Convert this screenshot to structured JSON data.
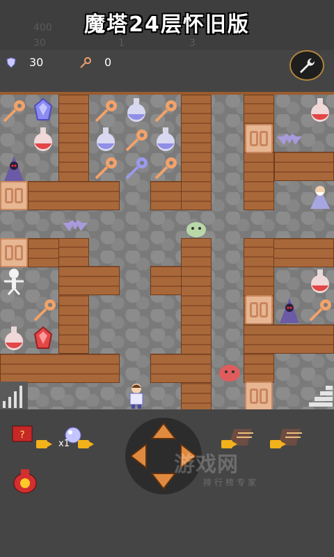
{
  "header": {
    "title": "魔塔24层怀旧版",
    "ghost_stats": [
      "400",
      "30",
      "1",
      "3"
    ]
  },
  "stats": {
    "defense": {
      "icon": "shield-icon",
      "value": "30"
    },
    "keys": {
      "icon": "key-icon",
      "value": "0"
    }
  },
  "settings": {
    "icon": "wrench-icon"
  },
  "inventory": {
    "book": {
      "icon": "monster-manual-icon"
    },
    "orb": {
      "icon": "crystal-orb-icon",
      "count": "x1"
    },
    "bag": {
      "icon": "lucky-bag-icon"
    },
    "stairs_up": {
      "icon": "fly-up-icon"
    },
    "stairs_down": {
      "icon": "fly-down-icon"
    }
  },
  "watermark": {
    "main": "游戏网",
    "sub": "排行榜专家"
  }
}
